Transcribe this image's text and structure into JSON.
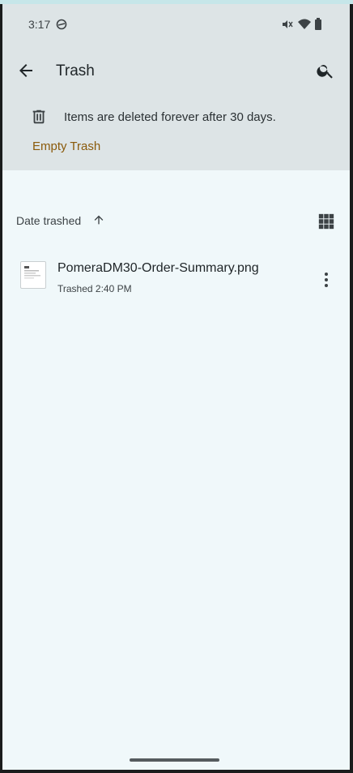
{
  "status_bar": {
    "time": "3:17"
  },
  "app_bar": {
    "title": "Trash",
    "back_icon": "arrow-back-icon",
    "search_icon": "search-icon"
  },
  "banner": {
    "icon": "trash-icon",
    "text": "Items are deleted forever after 30 days.",
    "action_label": "Empty Trash"
  },
  "sort": {
    "label": "Date trashed",
    "direction_icon": "arrow-up-icon",
    "view_toggle_icon": "grid-view-icon"
  },
  "files": [
    {
      "name": "PomeraDM30-Order-Summary.png",
      "meta": "Trashed 2:40 PM"
    }
  ],
  "colors": {
    "header_bg": "#dde4e6",
    "content_bg": "#f0f8fa",
    "accent": "#8a5a0b"
  }
}
